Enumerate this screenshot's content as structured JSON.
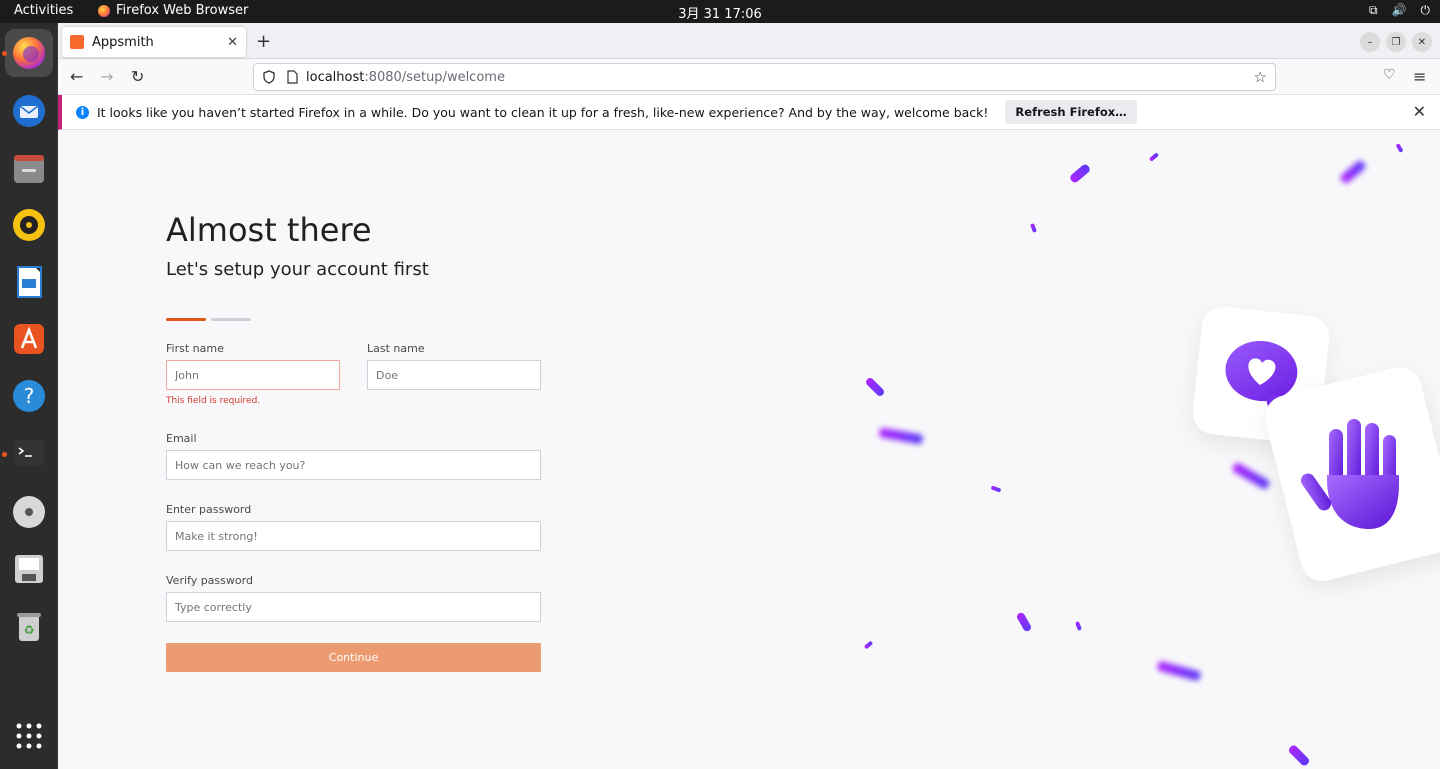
{
  "topbar": {
    "activities": "Activities",
    "app": "Firefox Web Browser",
    "clock": "3月 31  17:06"
  },
  "tab": {
    "title": "Appsmith"
  },
  "url": {
    "host": "localhost",
    "path": ":8080/setup/welcome"
  },
  "notification": {
    "message": "It looks like you haven’t started Firefox in a while. Do you want to clean it up for a fresh, like-new experience? And by the way, welcome back!",
    "button": "Refresh Firefox…"
  },
  "form": {
    "title": "Almost there",
    "subtitle": "Let's setup your account first",
    "first_name": {
      "label": "First name",
      "placeholder": "John",
      "error": "This field is required."
    },
    "last_name": {
      "label": "Last name",
      "placeholder": "Doe"
    },
    "email": {
      "label": "Email",
      "placeholder": "How can we reach you?"
    },
    "password": {
      "label": "Enter password",
      "placeholder": "Make it strong!"
    },
    "verify": {
      "label": "Verify password",
      "placeholder": "Type correctly"
    },
    "continue": "Continue"
  },
  "colors": {
    "accent": "#e15615",
    "button": "#ec9a6f",
    "error": "#d93b2e"
  }
}
